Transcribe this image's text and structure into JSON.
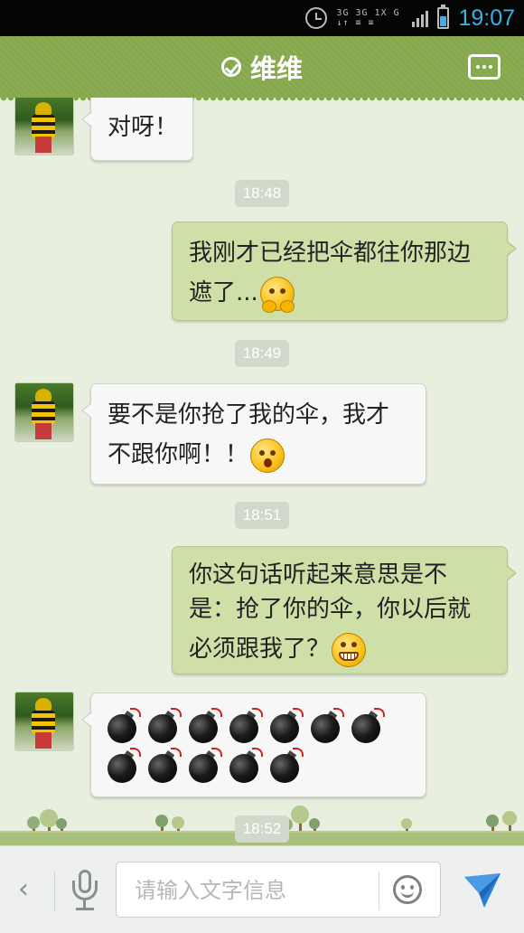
{
  "status_bar": {
    "network_top": "3G 3G 1X G",
    "network_bottom": "↓↑ ≡ ≡",
    "time": "19:07"
  },
  "header": {
    "title": "维维",
    "verified_icon": "check-circle-icon",
    "more_icon": "more-dots-icon",
    "accent_color": "#86a84c"
  },
  "messages": [
    {
      "from": "contact",
      "text": "对呀！"
    },
    {
      "timestamp": "18:48"
    },
    {
      "from": "me",
      "line1": "我刚才已经把伞都往你那边",
      "line2": "遮了...",
      "emoji": "shy-face-emoji"
    },
    {
      "timestamp": "18:49"
    },
    {
      "from": "contact",
      "line1": "要不是你抢了我的伞，我才",
      "line2": "不跟你啊！！",
      "emoji": "shocked-face-emoji"
    },
    {
      "timestamp": "18:51"
    },
    {
      "from": "me",
      "line1": "你这句话听起来意思是不",
      "line2": "是：抢了你的伞，你以后就",
      "line3": "必须跟我了？",
      "emoji": "grin-face-emoji"
    },
    {
      "from": "contact",
      "emoji": "bomb-emoji",
      "emoji_count": 12
    },
    {
      "timestamp": "18:52"
    }
  ],
  "input_bar": {
    "placeholder": "请输入文字信息",
    "back_icon": "chevron-left-icon",
    "mic_icon": "microphone-icon",
    "emoji_icon": "smiley-icon",
    "send_icon": "send-plane-icon",
    "send_color": "#2a7fd4"
  },
  "colors": {
    "incoming_bubble": "#f7f7f7",
    "outgoing_bubble": "#cfdfa8",
    "chat_background": "#e9efdf"
  }
}
